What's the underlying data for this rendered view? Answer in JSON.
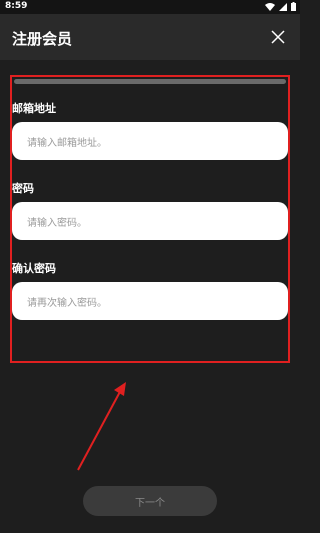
{
  "status_bar": {
    "time": "8:59"
  },
  "header": {
    "title": "注册会员"
  },
  "form": {
    "email": {
      "label": "邮箱地址",
      "placeholder": "请输入邮箱地址。"
    },
    "password": {
      "label": "密码",
      "placeholder": "请输入密码。"
    },
    "confirm_password": {
      "label": "确认密码",
      "placeholder": "请再次输入密码。"
    }
  },
  "footer": {
    "next_label": "下一个"
  },
  "colors": {
    "highlight": "#e02020",
    "background": "#1e1e1e",
    "header": "#2a2a2a"
  }
}
